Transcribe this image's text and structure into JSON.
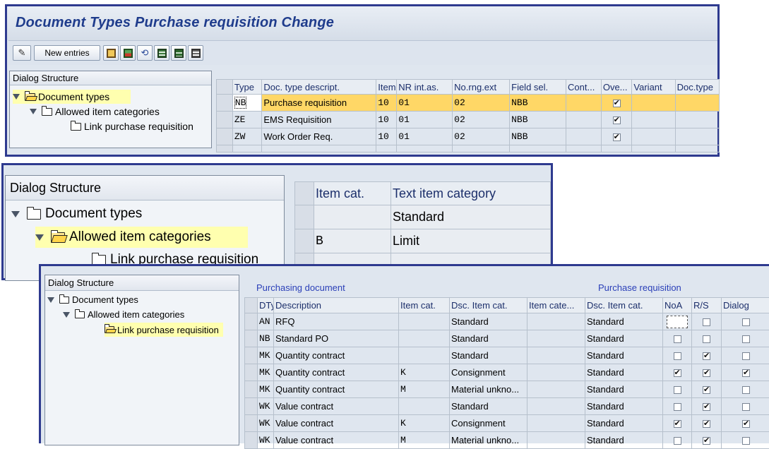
{
  "panel1": {
    "title": "Document Types Purchase requisition Change",
    "toolbar": {
      "new_entries": "New entries"
    },
    "dialog_structure": "Dialog Structure",
    "tree": [
      "Document types",
      "Allowed item categories",
      "Link purchase requisition"
    ],
    "table": {
      "headers": [
        "Type",
        "Doc. type descript.",
        "Item ...",
        "NR int.as.",
        "No.rng.ext",
        "Field sel.",
        "Cont...",
        "Ove...",
        "Variant",
        "Doc.type"
      ],
      "rows": [
        [
          "NB",
          "Purchase requisition",
          "10",
          "01",
          "02",
          "NBB",
          "",
          true,
          "",
          ""
        ],
        [
          "ZE",
          "EMS Requisition",
          "10",
          "01",
          "02",
          "NBB",
          "",
          true,
          "",
          ""
        ],
        [
          "ZW",
          "Work Order Req.",
          "10",
          "01",
          "02",
          "NBB",
          "",
          true,
          "",
          ""
        ]
      ]
    }
  },
  "panel2": {
    "dialog_structure": "Dialog Structure",
    "tree": [
      "Document types",
      "Allowed item categories",
      "Link purchase requisition"
    ],
    "table": {
      "headers": [
        "Item cat.",
        "Text item category"
      ],
      "rows": [
        [
          "",
          "Standard"
        ],
        [
          "B",
          "Limit"
        ]
      ]
    }
  },
  "panel3": {
    "dialog_structure": "Dialog Structure",
    "tree": [
      "Document types",
      "Allowed item categories",
      "Link purchase requisition"
    ],
    "group_purchasing": "Purchasing document",
    "group_requisition": "Purchase requisition",
    "table": {
      "headers": [
        "DTy.",
        "Description",
        "Item cat.",
        "Dsc. Item cat.",
        "Item cate...",
        "Dsc. Item cat.",
        "NoA",
        "R/S",
        "Dialog"
      ],
      "rows": [
        [
          "AN",
          "RFQ",
          "",
          "Standard",
          "",
          "Standard",
          false,
          false,
          false
        ],
        [
          "NB",
          "Standard PO",
          "",
          "Standard",
          "",
          "Standard",
          false,
          false,
          false
        ],
        [
          "MK",
          "Quantity contract",
          "",
          "Standard",
          "",
          "Standard",
          false,
          true,
          false
        ],
        [
          "MK",
          "Quantity contract",
          "K",
          "Consignment",
          "",
          "Standard",
          true,
          true,
          true
        ],
        [
          "MK",
          "Quantity contract",
          "M",
          "Material unkno...",
          "",
          "Standard",
          false,
          true,
          false
        ],
        [
          "WK",
          "Value contract",
          "",
          "Standard",
          "",
          "Standard",
          false,
          true,
          false
        ],
        [
          "WK",
          "Value contract",
          "K",
          "Consignment",
          "",
          "Standard",
          true,
          true,
          true
        ],
        [
          "WK",
          "Value contract",
          "M",
          "Material unkno...",
          "",
          "Standard",
          false,
          true,
          false
        ]
      ]
    }
  },
  "colors": {
    "frame": "#2e3a8f",
    "title": "#1f3c8c",
    "selected_row": "#ffd766",
    "tree_highlight": "#ffffaf"
  }
}
